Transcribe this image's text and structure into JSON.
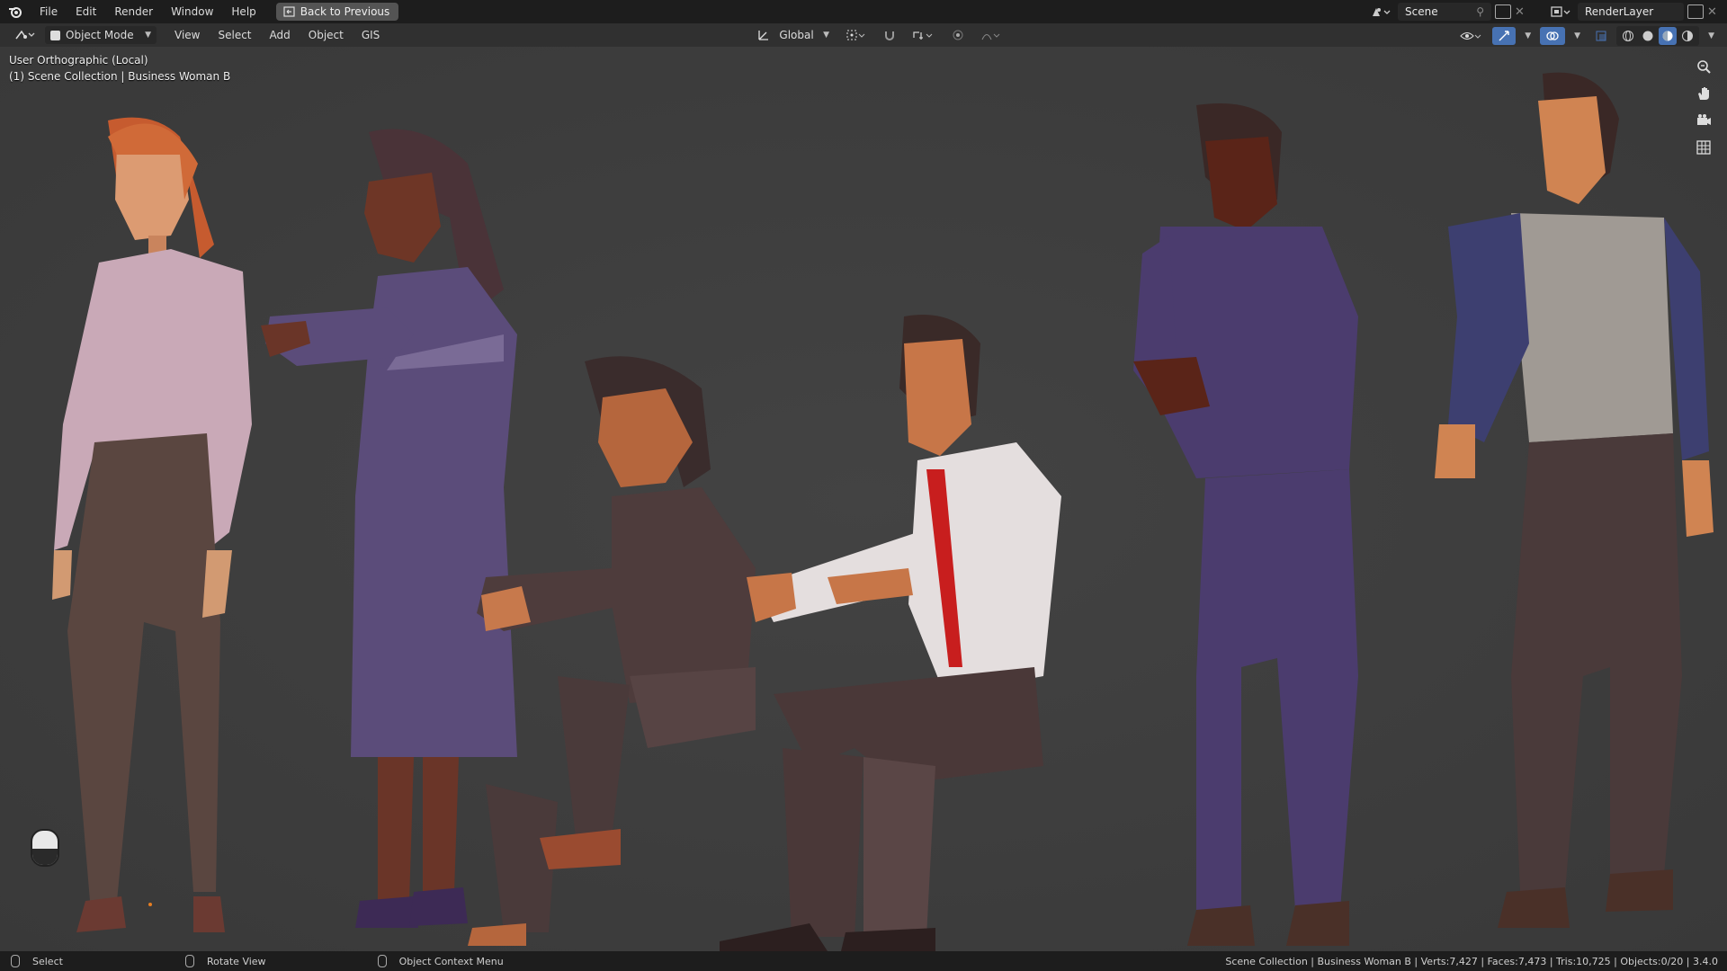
{
  "topbar": {
    "menus": [
      "File",
      "Edit",
      "Render",
      "Window",
      "Help"
    ],
    "back_label": "Back to Previous",
    "scene_name": "Scene",
    "render_layer": "RenderLayer"
  },
  "header": {
    "mode": "Object Mode",
    "menus": [
      "View",
      "Select",
      "Add",
      "Object",
      "GIS"
    ],
    "orientation": "Global"
  },
  "viewport": {
    "view_name": "User Orthographic (Local)",
    "collection_info": "(1) Scene Collection | Business Woman B"
  },
  "statusbar": {
    "select": "Select",
    "rotate": "Rotate View",
    "context": "Object Context Menu",
    "stats": "Scene Collection | Business Woman B | Verts:7,427 | Faces:7,473 | Tris:10,725 | Objects:0/20 | 3.4.0"
  },
  "colors": {
    "accent_blue": "#4772b3",
    "topbar_bg": "#1d1d1d",
    "viewport_bg": "#3d3d3d"
  }
}
